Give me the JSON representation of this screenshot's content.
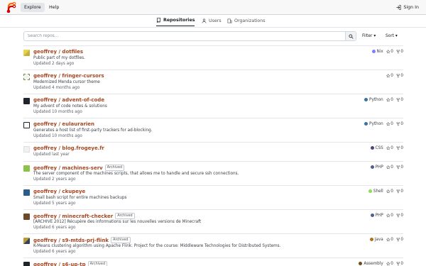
{
  "nav": {
    "explore": "Explore",
    "help": "Help",
    "sign_in": "Sign In"
  },
  "tabs": {
    "repositories": "Repositories",
    "users": "Users",
    "organizations": "Organizations"
  },
  "search": {
    "placeholder": "Search repos…",
    "filter": "Filter",
    "sort": "Sort"
  },
  "colors": {
    "accent": "#a9451f",
    "lang_nix": "#7e7eff",
    "lang_python": "#3572a5",
    "lang_css": "#563d7c",
    "lang_php": "#4f5d95",
    "lang_shell": "#89e051",
    "lang_java": "#b07219",
    "lang_assembly": "#6e4c13"
  },
  "repos": [
    {
      "owner": "geoffrey",
      "name": "dotfiles",
      "description": "Public part of my dotfiles.",
      "updated": "Updated 2 days ago",
      "language": "Nix",
      "stars": "0",
      "forks": "0",
      "archived": ""
    },
    {
      "owner": "geoffrey",
      "name": "fringer-cursors",
      "description": "Modernized Menda cursor theme",
      "updated": "Updated 4 months ago",
      "language": "",
      "stars": "0",
      "forks": "0",
      "archived": ""
    },
    {
      "owner": "geoffrey",
      "name": "advent-of-code",
      "description": "My advent of code notes & solutions",
      "updated": "Updated 10 months ago",
      "language": "Python",
      "stars": "0",
      "forks": "0",
      "archived": ""
    },
    {
      "owner": "geoffrey",
      "name": "eulaurarien",
      "description": "Generates a host list of first-party trackers for ad-blocking.",
      "updated": "Updated 10 months ago",
      "language": "Python",
      "stars": "0",
      "forks": "0",
      "archived": ""
    },
    {
      "owner": "geoffrey",
      "name": "blog.frogeye.fr",
      "description": "",
      "updated": "Updated last year",
      "language": "CSS",
      "stars": "0",
      "forks": "0",
      "archived": ""
    },
    {
      "owner": "geoffrey",
      "name": "machines-serv",
      "description": "The server component of the machines scripts, that allows me to handle and secure ssh connections.",
      "updated": "Updated 2 years ago",
      "language": "PHP",
      "stars": "0",
      "forks": "0",
      "archived": "Archived"
    },
    {
      "owner": "geoffrey",
      "name": "ckupeye",
      "description": "Small bash script for entire machines backups",
      "updated": "Updated 5 years ago",
      "language": "Shell",
      "stars": "0",
      "forks": "0",
      "archived": ""
    },
    {
      "owner": "geoffrey",
      "name": "minecraft-checker",
      "description": "[ARCHIVE 2012] Récupère des informations sur les nouvelles versions de Minecraft",
      "updated": "Updated 6 years ago",
      "language": "PHP",
      "stars": "0",
      "forks": "0",
      "archived": "Archived"
    },
    {
      "owner": "geoffrey",
      "name": "s9-mtds-prj-flink",
      "description": "K-Means clustering algorithm using Apache Flink. Project for the course: Middleware Technologies for Distributed Systems.",
      "updated": "Updated 6 years ago",
      "language": "Java",
      "stars": "0",
      "forks": "0",
      "archived": "Archived"
    },
    {
      "owner": "geoffrey",
      "name": "s6-up-tp",
      "description": "",
      "updated": "",
      "language": "Assembly",
      "stars": "0",
      "forks": "0",
      "archived": "Archived"
    }
  ]
}
